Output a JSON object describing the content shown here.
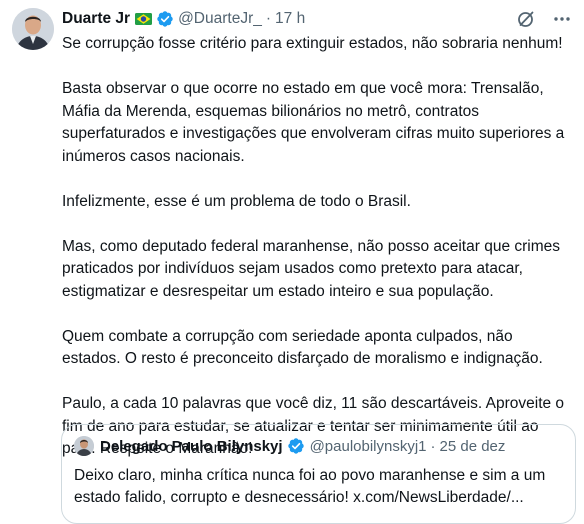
{
  "post": {
    "author_name": "Duarte Jr",
    "author_handle": "@DuarteJr_",
    "separator": "·",
    "time": "17 h",
    "paragraphs": [
      "Se corrupção fosse critério para extinguir estados, não sobraria nenhum!",
      "Basta observar o que ocorre no estado em que você mora: Trensalão, Máfia da Merenda, esquemas bilionários no metrô, contratos superfaturados e investigações que envolveram cifras muito superiores a inúmeros casos nacionais.",
      "Infelizmente, esse é um problema de todo o Brasil.",
      "Mas, como deputado federal maranhense, não posso aceitar que crimes praticados por indivíduos sejam usados como pretexto para atacar, estigmatizar e desrespeitar um estado inteiro e sua população.",
      "Quem combate a corrupção com seriedade aponta culpados, não estados. O resto é preconceito disfarçado de moralismo e indignação.",
      "Paulo, a cada 10 palavras que você diz, 11 são descartáveis. Aproveite o fim de ano para estudar, se atualizar e tentar ser minimamente útil ao país. Respeite o Maranhão!"
    ]
  },
  "quoted": {
    "author_name": "Delegado Paulo Bilynskyj",
    "author_handle": "@paulobilynskyj1",
    "separator": "·",
    "date": "25 de dez",
    "text": "Deixo claro, minha crítica nunca foi ao povo maranhense e sim a um estado falido, corrupto e desnecessário! x.com/NewsLiberdade/..."
  },
  "icons": {
    "flag": "brazil-flag-icon",
    "verified": "verified-badge-icon",
    "grok": "grok-icon",
    "more": "more-icon"
  },
  "colors": {
    "verified": "#1d9bf0",
    "secondary_text": "#536471",
    "border": "#cfd9de"
  }
}
